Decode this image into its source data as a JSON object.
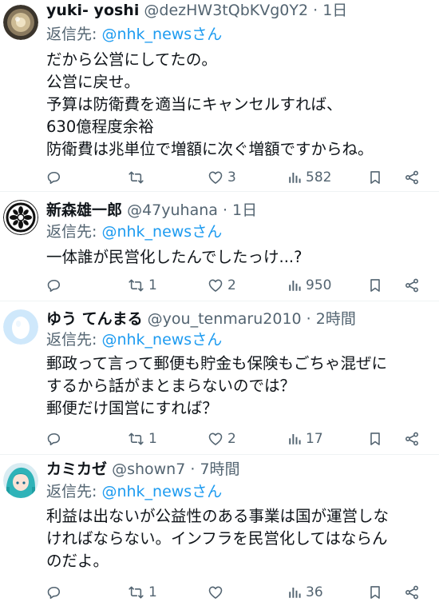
{
  "ui": {
    "reply_prefix": "返信先:",
    "dot": "·"
  },
  "tweets": [
    {
      "name": "yuki- yoshi",
      "handle": "@dezHW3tQbKVg0Y2",
      "time": "1日",
      "reply_to": "@nhk_newsさん",
      "lines": [
        "だから公営にしてたの。",
        "公営に戻せ。",
        "予算は防衛費を適当にキャンセルすれば、",
        "630億程度余裕",
        "防衛費は兆単位で増額に次ぐ増額ですからね。"
      ],
      "replies": "",
      "retweets": "",
      "likes": "3",
      "views": "582"
    },
    {
      "name": "新森雄一郎",
      "handle": "@47yuhana",
      "time": "1日",
      "reply_to": "@nhk_newsさん",
      "lines": [
        "一体誰が民営化したんでしたっけ...?"
      ],
      "replies": "",
      "retweets": "1",
      "likes": "2",
      "views": "950"
    },
    {
      "name": "ゆう てんまる",
      "handle": "@you_tenmaru2010",
      "time": "2時間",
      "reply_to": "@nhk_newsさん",
      "lines": [
        "郵政って言って郵便も貯金も保険もごちゃ混ぜに",
        "するから話がまとまらないのでは？",
        "郵便だけ国営にすれば？"
      ],
      "replies": "",
      "retweets": "1",
      "likes": "2",
      "views": "17"
    },
    {
      "name": "カミカゼ",
      "handle": "@shown7",
      "time": "7時間",
      "reply_to": "@nhk_newsさん",
      "lines": [
        "利益は出ないが公益性のある事業は国が運営しな",
        "ければならない。インフラを民営化してはならん",
        "のだよ。"
      ],
      "replies": "",
      "retweets": "1",
      "likes": "",
      "views": "36"
    }
  ]
}
